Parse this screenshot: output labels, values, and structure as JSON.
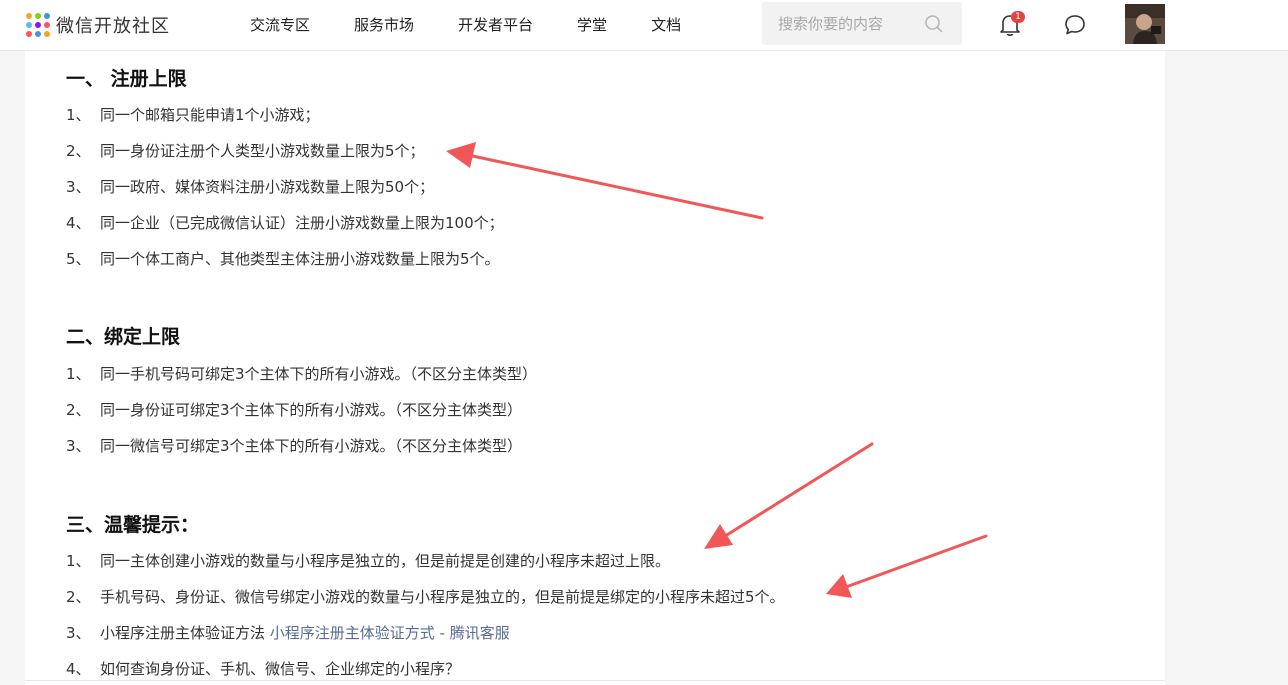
{
  "header": {
    "brand": "微信开放社区",
    "nav": [
      "交流专区",
      "服务市场",
      "开发者平台",
      "学堂",
      "文档"
    ],
    "search_placeholder": "搜索你要的内容",
    "notification_count": "1",
    "icons": {
      "logo": "wechat-open-community-logo",
      "search": "search-icon",
      "bell": "bell-icon",
      "chat": "chat-bubble-icon"
    },
    "colors": {
      "badge": "#e64340",
      "link": "#576b95",
      "arrow": "#f25757"
    }
  },
  "article": {
    "sections": [
      {
        "title": "一、  注册上限",
        "items": [
          {
            "num": "1、",
            "text": "同一个邮箱只能申请1个小游戏；"
          },
          {
            "num": "2、",
            "text": "同一身份证注册个人类型小游戏数量上限为5个；"
          },
          {
            "num": "3、",
            "text": "同一政府、媒体资料注册小游戏数量上限为50个；"
          },
          {
            "num": "4、",
            "text": "同一企业（已完成微信认证）注册小游戏数量上限为100个；"
          },
          {
            "num": "5、",
            "text": "同一个体工商户、其他类型主体注册小游戏数量上限为5个。"
          }
        ]
      },
      {
        "title": "二、绑定上限",
        "items": [
          {
            "num": "1、",
            "text": "同一手机号码可绑定3个主体下的所有小游戏。（不区分主体类型）"
          },
          {
            "num": "2、",
            "text": "同一身份证可绑定3个主体下的所有小游戏。（不区分主体类型）"
          },
          {
            "num": "3、",
            "text": "同一微信号可绑定3个主体下的所有小游戏。（不区分主体类型）"
          }
        ]
      },
      {
        "title": "三、温馨提示：",
        "items": [
          {
            "num": "1、",
            "text": "同一主体创建小游戏的数量与小程序是独立的，但是前提是创建的小程序未超过上限。"
          },
          {
            "num": "2、",
            "text": "手机号码、身份证、微信号绑定小游戏的数量与小程序是独立的，但是前提是绑定的小程序未超过5个。"
          },
          {
            "num": "3、",
            "text": "小程序注册主体验证方法 ",
            "link": "小程序注册主体验证方式 - 腾讯客服"
          },
          {
            "num": "4、",
            "text": "如何查询身份证、手机、微信号、企业绑定的小程序？"
          }
        ]
      }
    ]
  }
}
